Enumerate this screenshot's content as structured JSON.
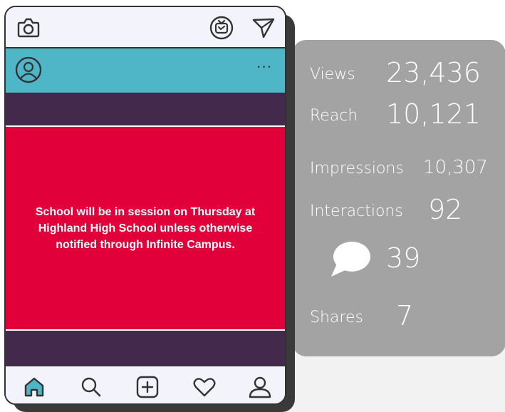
{
  "phone": {
    "post_text": "School will be in session on Thursday at Highland High School unless otherwise notified through Infinite Campus.",
    "more_menu": "···",
    "icons": {
      "camera": "camera-icon",
      "igtv": "igtv-icon",
      "send": "send-icon",
      "profile": "avatar-icon",
      "nav": [
        "home-icon",
        "search-icon",
        "add-post-icon",
        "heart-icon",
        "profile-icon"
      ]
    }
  },
  "stats": {
    "views_label": "Views",
    "views_value": "23,436",
    "reach_label": "Reach",
    "reach_value": "10,121",
    "impressions_label": "Impressions",
    "impressions_value": "10,307",
    "interactions_label": "Interactions",
    "interactions_value": "92",
    "comments_value": "39",
    "shares_label": "Shares",
    "shares_value": "7"
  },
  "colors": {
    "profile_bar": "#4fb6c7",
    "post_frame": "#432a4c",
    "post_background": "#e2003a",
    "stats_card": "#a3a3a3",
    "home_icon_fill": "#4fb6c7"
  }
}
